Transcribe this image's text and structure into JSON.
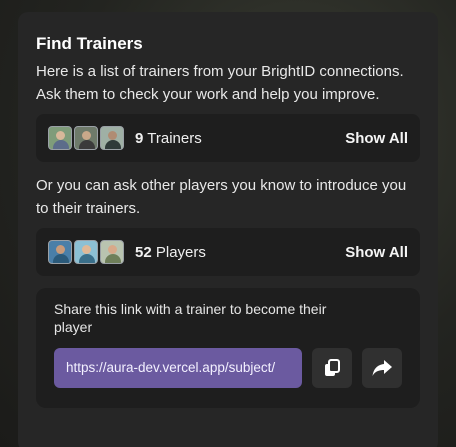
{
  "trainers_section": {
    "title": "Find Trainers",
    "description": "Here is a list of trainers from your BrightID connections. Ask them to check your work and help you improve.",
    "count": "9",
    "count_label": "Trainers",
    "show_all_label": "Show All",
    "avatars": [
      {
        "name": "avatar",
        "bg": "#7f9c7a",
        "head": "#d8b89a",
        "body": "#5c6c8a"
      },
      {
        "name": "avatar",
        "bg": "#6e7a6a",
        "head": "#c9a88a",
        "body": "#3b3b3b"
      },
      {
        "name": "avatar",
        "bg": "#9fb0a5",
        "head": "#b08c73",
        "body": "#2f3a3a"
      }
    ]
  },
  "players_section": {
    "description": "Or you can ask other players you know to introduce you to their trainers.",
    "count": "52",
    "count_label": "Players",
    "show_all_label": "Show All",
    "avatars": [
      {
        "name": "avatar",
        "bg": "#4a7fa8",
        "head": "#c99b7a",
        "body": "#2b5a7a"
      },
      {
        "name": "avatar",
        "bg": "#8cc0d4",
        "head": "#e0b896",
        "body": "#3a6f8a"
      },
      {
        "name": "avatar",
        "bg": "#b9c4b0",
        "head": "#d8a98a",
        "body": "#6f7f5a"
      }
    ]
  },
  "share_section": {
    "text": "Share this link with a trainer to become their player",
    "link": "https://aura-dev.vercel.app/subject/",
    "copy_icon": "copy-icon",
    "share_icon": "share-icon"
  }
}
